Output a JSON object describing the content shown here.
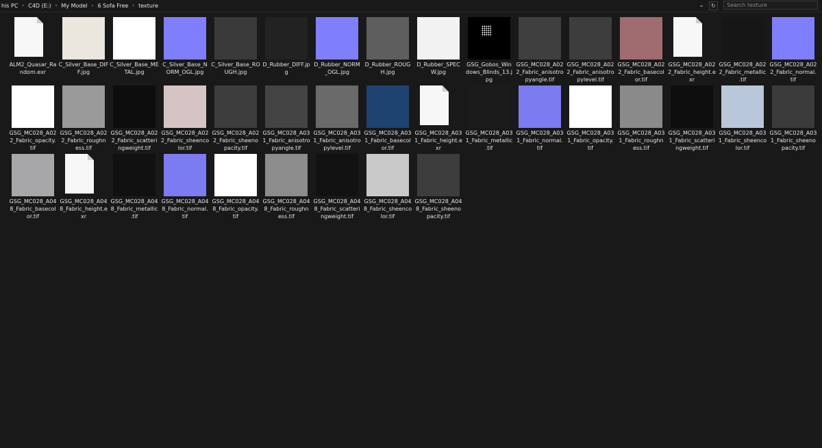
{
  "address_bar": {
    "breadcrumbs": [
      "his PC",
      "C4D (E:)",
      "My Model",
      "6 Sofa Free",
      "texture"
    ],
    "dropdown_glyph": "⌄",
    "refresh_glyph": "↻",
    "search_placeholder": "Search texture"
  },
  "colors": {
    "background": "#191919",
    "text": "#e6e6e6"
  },
  "files": [
    {
      "name": "ALM2_Quasar_Random.exr",
      "label": "ALM2_Quasar_Ra\nndom.exr",
      "thumb": "doc"
    },
    {
      "name": "C_Silver_Base_DIFF.jpg",
      "label": "C_Silver_Base_DIF\nF.jpg",
      "thumb": "#ebe7de"
    },
    {
      "name": "C_Silver_Base_METAL.jpg",
      "label": "C_Silver_Base_ME\nTAL.jpg",
      "thumb": "#ffffff"
    },
    {
      "name": "C_Silver_Base_NORM_OGL.jpg",
      "label": "C_Silver_Base_N\nORM_OGL.jpg",
      "thumb": "#7f7ffd"
    },
    {
      "name": "C_Silver_Base_ROUGH.jpg",
      "label": "C_Silver_Base_RO\nUGH.jpg",
      "thumb": "#3a3a3a"
    },
    {
      "name": "D_Rubber_DIFF.jpg",
      "label": "D_Rubber_DIFF.jp\ng",
      "thumb": "#222222"
    },
    {
      "name": "D_Rubber_NORM_OGL.jpg",
      "label": "D_Rubber_NORM\n_OGL.jpg",
      "thumb": "#7f7ffd"
    },
    {
      "name": "D_Rubber_ROUGH.jpg",
      "label": "D_Rubber_ROUG\nH.jpg",
      "thumb": "#5e5e5e"
    },
    {
      "name": "D_Rubber_SPECW.jpg",
      "label": "D_Rubber_SPEC\nW.jpg",
      "thumb": "#f2f2f2"
    },
    {
      "name": "GSG_Gobos_Windows_Blinds_13.jpg",
      "label": "GSG_Gobos_Win\ndows_Blinds_13.j\npg",
      "thumb": "#000000",
      "gobo": true
    },
    {
      "name": "GSG_MC028_A022_Fabric_anisotropyangle.tif",
      "label": "GSG_MC028_A02\n2_Fabric_anisotro\npyangle.tif",
      "thumb": "#3f3f3f"
    },
    {
      "name": "GSG_MC028_A022_Fabric_anisotropylevel.tif",
      "label": "GSG_MC028_A02\n2_Fabric_anisotro\npylevel.tif",
      "thumb": "#3d3d3d"
    },
    {
      "name": "GSG_MC028_A022_Fabric_basecolor.tif",
      "label": "GSG_MC028_A02\n2_Fabric_basecol\nor.tif",
      "thumb": "#a06c70"
    },
    {
      "name": "GSG_MC028_A022_Fabric_height.exr",
      "label": "GSG_MC028_A02\n2_Fabric_height.e\nxr",
      "thumb": "doc"
    },
    {
      "name": "GSG_MC028_A022_Fabric_metallic.tif",
      "label": "GSG_MC028_A02\n2_Fabric_metallic\n.tif",
      "thumb": "#161616"
    },
    {
      "name": "GSG_MC028_A022_Fabric_normal.tif",
      "label": "GSG_MC028_A02\n2_Fabric_normal.\ntif",
      "thumb": "#7f7ffd"
    },
    {
      "name": "GSG_MC028_A022_Fabric_opacity.tif",
      "label": "GSG_MC028_A02\n2_Fabric_opacity.\ntif",
      "thumb": "#ffffff"
    },
    {
      "name": "GSG_MC028_A022_Fabric_roughness.tif",
      "label": "GSG_MC028_A02\n2_Fabric_roughn\ness.tif",
      "thumb": "#9a9a9a"
    },
    {
      "name": "GSG_MC028_A022_Fabric_scatteringweight.tif",
      "label": "GSG_MC028_A02\n2_Fabric_scatteri\nngweight.tif",
      "thumb": "#0d0d0d"
    },
    {
      "name": "GSG_MC028_A022_Fabric_sheencolor.tif",
      "label": "GSG_MC028_A02\n2_Fabric_sheenco\nlor.tif",
      "thumb": "#d6c4c4"
    },
    {
      "name": "GSG_MC028_A022_Fabric_sheenopacity.tif",
      "label": "GSG_MC028_A02\n2_Fabric_sheeno\npacity.tif",
      "thumb": "#3d3d3d"
    },
    {
      "name": "GSG_MC028_A031_Fabric_anisotropyangle.tif",
      "label": "GSG_MC028_A03\n1_Fabric_anisotro\npyangle.tif",
      "thumb": "#444444"
    },
    {
      "name": "GSG_MC028_A031_Fabric_anisotropylevel.tif",
      "label": "GSG_MC028_A03\n1_Fabric_anisotro\npylevel.tif",
      "thumb": "#6a6a6a"
    },
    {
      "name": "GSG_MC028_A031_Fabric_basecolor.tif",
      "label": "GSG_MC028_A03\n1_Fabric_basecol\nor.tif",
      "thumb": "#1f4370"
    },
    {
      "name": "GSG_MC028_A031_Fabric_height.exr",
      "label": "GSG_MC028_A03\n1_Fabric_height.e\nxr",
      "thumb": "doc"
    },
    {
      "name": "GSG_MC028_A031_Fabric_metallic.tif",
      "label": "GSG_MC028_A03\n1_Fabric_metallic\n.tif",
      "thumb": "#1b1b1b"
    },
    {
      "name": "GSG_MC028_A031_Fabric_normal.tif",
      "label": "GSG_MC028_A03\n1_Fabric_normal.\ntif",
      "thumb": "#7d7bf0"
    },
    {
      "name": "GSG_MC028_A031_Fabric_opacity.tif",
      "label": "GSG_MC028_A03\n1_Fabric_opacity.\ntif",
      "thumb": "#ffffff"
    },
    {
      "name": "GSG_MC028_A031_Fabric_roughness.tif",
      "label": "GSG_MC028_A03\n1_Fabric_roughn\ness.tif",
      "thumb": "#8a8a8a"
    },
    {
      "name": "GSG_MC028_A031_Fabric_scatteringweight.tif",
      "label": "GSG_MC028_A03\n1_Fabric_scatteri\nngweight.tif",
      "thumb": "#0e0e0e"
    },
    {
      "name": "GSG_MC028_A031_Fabric_sheencolor.tif",
      "label": "GSG_MC028_A03\n1_Fabric_sheenco\nlor.tif",
      "thumb": "#b9c7da"
    },
    {
      "name": "GSG_MC028_A031_Fabric_sheenopacity.tif",
      "label": "GSG_MC028_A03\n1_Fabric_sheeno\npacity.tif",
      "thumb": "#3b3b3b"
    },
    {
      "name": "GSG_MC028_A048_Fabric_basecolor.tif",
      "label": "GSG_MC028_A04\n8_Fabric_basecol\nor.tif",
      "thumb": "#a7a7aa"
    },
    {
      "name": "GSG_MC028_A048_Fabric_height.exr",
      "label": "GSG_MC028_A04\n8_Fabric_height.e\nxr",
      "thumb": "doc"
    },
    {
      "name": "GSG_MC028_A048_Fabric_metallic.tif",
      "label": "GSG_MC028_A04\n8_Fabric_metallic\n.tif",
      "thumb": "#111111"
    },
    {
      "name": "GSG_MC028_A048_Fabric_normal.tif",
      "label": "GSG_MC028_A04\n8_Fabric_normal.\ntif",
      "thumb": "#7d7bf0"
    },
    {
      "name": "GSG_MC028_A048_Fabric_opacity.tif",
      "label": "GSG_MC028_A04\n8_Fabric_opacity.\ntif",
      "thumb": "#ffffff"
    },
    {
      "name": "GSG_MC028_A048_Fabric_roughness.tif",
      "label": "GSG_MC028_A04\n8_Fabric_roughn\ness.tif",
      "thumb": "#8c8c8c"
    },
    {
      "name": "GSG_MC028_A048_Fabric_scatteringweight.tif",
      "label": "GSG_MC028_A04\n8_Fabric_scatteri\nngweight.tif",
      "thumb": "#121212"
    },
    {
      "name": "GSG_MC028_A048_Fabric_sheencolor.tif",
      "label": "GSG_MC028_A04\n8_Fabric_sheenco\nlor.tif",
      "thumb": "#c9c9c9"
    },
    {
      "name": "GSG_MC028_A048_Fabric_sheenopacity.tif",
      "label": "GSG_MC028_A04\n8_Fabric_sheeno\npacity.tif",
      "thumb": "#3d3d3d"
    }
  ]
}
